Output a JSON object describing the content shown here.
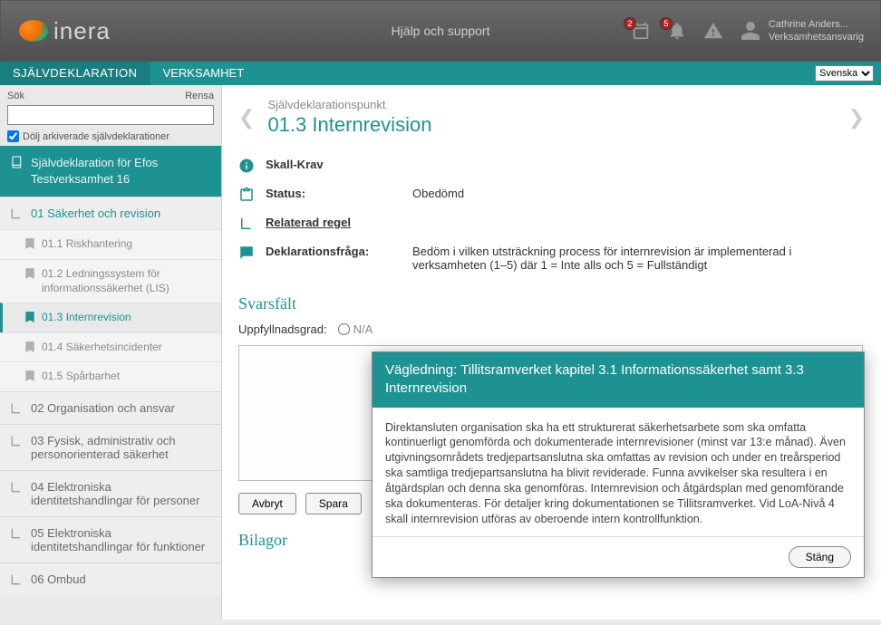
{
  "header": {
    "logo_text": "inera",
    "center_link": "Hjälp och support",
    "badge_calendar": "2",
    "badge_bell": "5",
    "user_name": "Cathrine Anders...",
    "user_role": "Verksamhetsansvarig"
  },
  "topnav": {
    "tab1": "SJÄLVDEKLARATION",
    "tab2": "VERKSAMHET",
    "lang_selected": "Svenska"
  },
  "sidebar": {
    "search_label": "Sök",
    "clear_label": "Rensa",
    "hide_archived_label": "Dölj arkiverade självdeklarationer",
    "root": "Självdeklaration för Efos Testverksamhet 16",
    "groups": [
      {
        "label": "01 Säkerhet och revision",
        "open": true,
        "items": [
          {
            "label": "01.1 Riskhantering"
          },
          {
            "label": "01.2 Ledningssystem för informationssäkerhet (LIS)"
          },
          {
            "label": "01.3 Internrevision",
            "active": true
          },
          {
            "label": "01.4 Säkerhetsincidenter"
          },
          {
            "label": "01.5 Spårbarhet"
          }
        ]
      },
      {
        "label": "02 Organisation och ansvar"
      },
      {
        "label": "03 Fysisk, administrativ och personorienterad säkerhet"
      },
      {
        "label": "04 Elektroniska identitetshandlingar för personer"
      },
      {
        "label": "05 Elektroniska identitetshandlingar för funktioner"
      },
      {
        "label": "06 Ombud"
      }
    ]
  },
  "main": {
    "sup_title": "Självdeklarationspunkt",
    "title": "01.3 Internrevision",
    "rows": {
      "req_label": "Skall-Krav",
      "status_label": "Status:",
      "status_value": "Obedömd",
      "rule_label": "Relaterad regel",
      "question_label": "Deklarationsfråga:",
      "question_value": "Bedöm i vilken utsträckning process för internrevision är implementerad i verksamheten (1–5) där 1 = Inte alls och 5 = Fullständigt"
    },
    "answer_section_title": "Svarsfält",
    "fulfil_label": "Uppfyllnadsgrad:",
    "radio_na": "N/A",
    "btn_cancel": "Avbryt",
    "btn_save": "Spara",
    "attachments_title": "Bilagor"
  },
  "modal": {
    "title": "Vägledning: Tillitsramverket kapitel 3.1 Informationssäkerhet samt 3.3 Internrevision",
    "body": "Direktansluten organisation ska ha ett strukturerat säkerhetsarbete som ska omfatta kontinuerligt genomförda och dokumenterade internrevisioner (minst var 13:e månad). Även utgivningsområdets tredjepartsanslutna ska omfattas av revision och under en treårsperiod ska samtliga tredjepartsanslutna ha blivit reviderade. Funna avvikelser ska resultera i en åtgärdsplan och denna ska genomföras. Internrevision och åtgärdsplan med genomförande ska dokumenteras. För detaljer kring dokumentationen se Tillitsramverket. Vid LoA-Nivå 4 skall internrevision utföras av oberoende intern kontrollfunktion.",
    "close": "Stäng"
  }
}
